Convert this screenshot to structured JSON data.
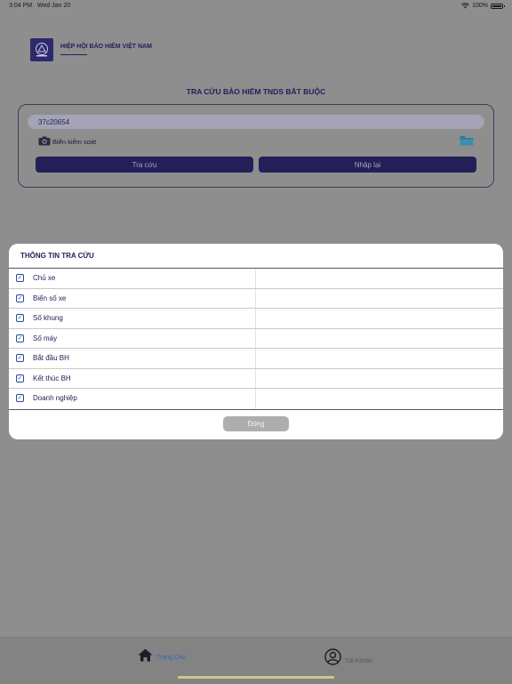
{
  "status_bar": {
    "time": "3:04 PM",
    "date": "Wed Jan 20",
    "battery": "100%"
  },
  "header": {
    "org_name": "HIỆP HỘI BẢO HIỂM VIỆT NAM"
  },
  "page": {
    "title": "TRA CỨU BẢO HIỂM TNDS BẮT BUỘC"
  },
  "search": {
    "plate_value": "37c20654",
    "plate_label": "Biển kiểm soát",
    "search_button": "Tra cứu",
    "reset_button": "Nhập lại"
  },
  "modal": {
    "title": "THÔNG TIN TRA CỨU",
    "rows": [
      {
        "label": "Chủ xe",
        "checked": true
      },
      {
        "label": "Biển số xe",
        "checked": true
      },
      {
        "label": "Số khung",
        "checked": true
      },
      {
        "label": "Số máy",
        "checked": true
      },
      {
        "label": "Bắt đầu BH",
        "checked": true
      },
      {
        "label": "Kết thúc BH",
        "checked": true
      },
      {
        "label": "Doanh nghiệp",
        "checked": true
      }
    ],
    "close_button": "Đóng"
  },
  "tabbar": {
    "tabs": [
      {
        "label": "Trang Chủ",
        "icon": "home-icon",
        "active": true
      },
      {
        "label": "Tài Khoản",
        "icon": "account-icon",
        "active": false
      }
    ]
  },
  "colors": {
    "primary": "#232058",
    "accent": "#2e66c0",
    "overlay": "#8e8e8f"
  }
}
